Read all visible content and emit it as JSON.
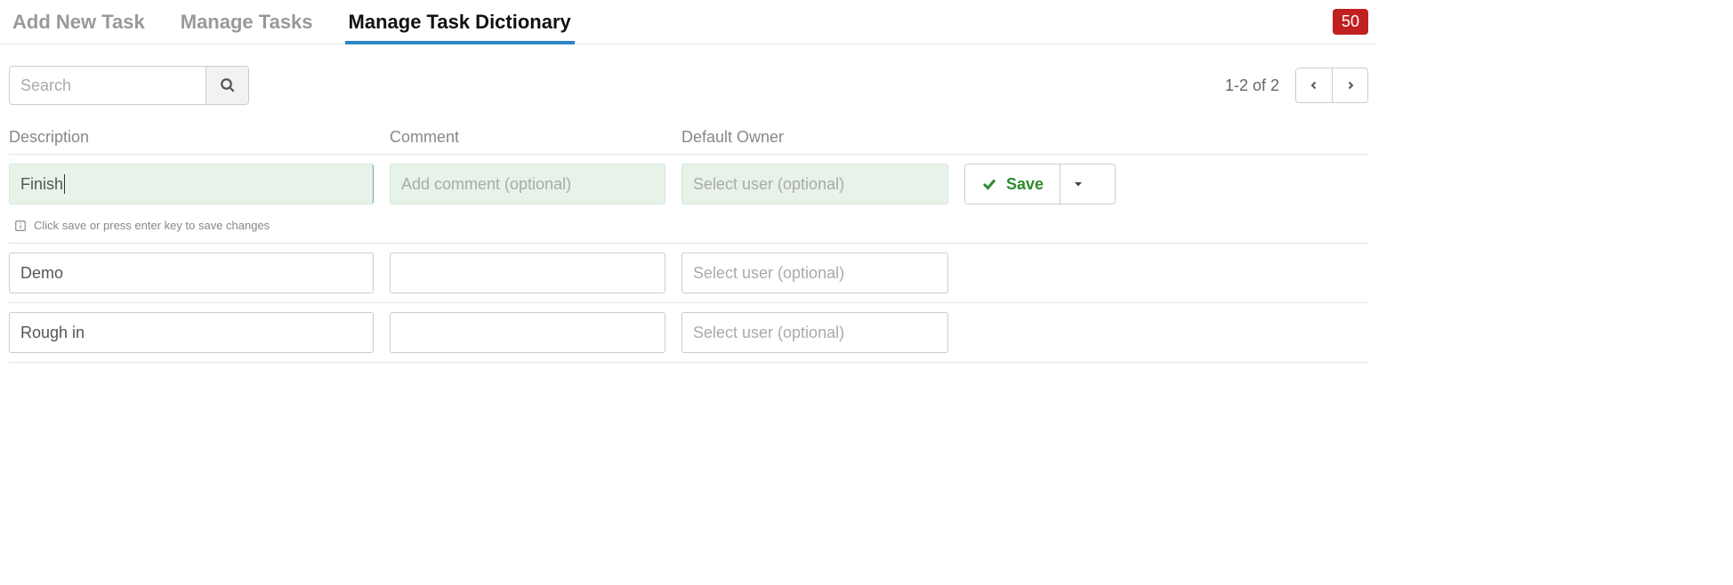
{
  "tabs": {
    "add_new_task": "Add New Task",
    "manage_tasks": "Manage Tasks",
    "manage_dictionary": "Manage Task Dictionary"
  },
  "badge_count": "50",
  "search": {
    "placeholder": "Search"
  },
  "pager": {
    "range_text": "1-2 of 2"
  },
  "columns": {
    "description": "Description",
    "comment": "Comment",
    "default_owner": "Default Owner"
  },
  "edit_row": {
    "description_value": "Finish",
    "comment_placeholder": "Add comment (optional)",
    "owner_placeholder": "Select user (optional)",
    "save_label": "Save"
  },
  "hint_text": "Click save or press enter key to save changes",
  "rows": [
    {
      "description": "Demo",
      "comment": "",
      "owner_placeholder": "Select user (optional)"
    },
    {
      "description": "Rough in",
      "comment": "",
      "owner_placeholder": "Select user (optional)"
    }
  ]
}
